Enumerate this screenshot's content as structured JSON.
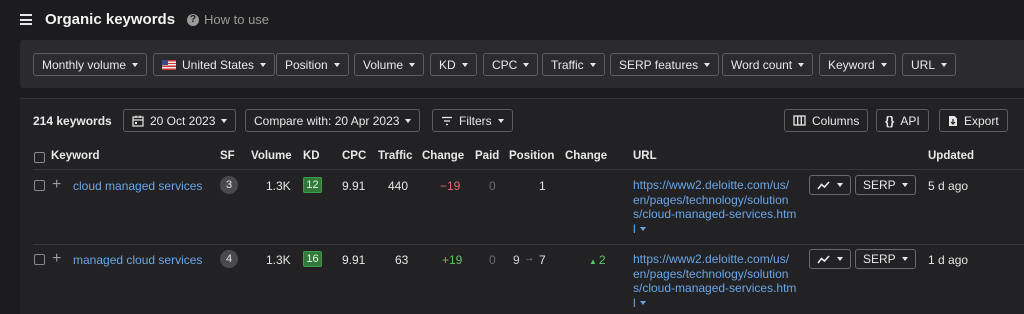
{
  "header": {
    "title": "Organic keywords",
    "how_to_use": "How to use"
  },
  "filters": [
    {
      "label": "Monthly volume"
    },
    {
      "label": "United States",
      "flag": "us-flag"
    },
    {
      "label": "Position"
    },
    {
      "label": "Volume"
    },
    {
      "label": "KD"
    },
    {
      "label": "CPC"
    },
    {
      "label": "Traffic"
    },
    {
      "label": "SERP features"
    },
    {
      "label": "Word count"
    },
    {
      "label": "Keyword"
    },
    {
      "label": "URL"
    }
  ],
  "toolbar": {
    "count": "214 keywords",
    "date": "20 Oct 2023",
    "compare": "Compare with: 20 Apr 2023",
    "filters_label": "Filters",
    "columns_label": "Columns",
    "api_label": "API",
    "export_label": "Export"
  },
  "table": {
    "columns": [
      "Keyword",
      "SF",
      "Volume",
      "KD",
      "CPC",
      "Traffic",
      "Change",
      "Paid",
      "Position",
      "Change",
      "URL",
      "Updated"
    ],
    "rows": [
      {
        "keyword": "cloud managed services",
        "sf": "3",
        "volume": "1.3K",
        "kd": "12",
        "cpc": "9.91",
        "traffic": "440",
        "traffic_change": "−19",
        "paid": "0",
        "position_from": "",
        "position": "1",
        "position_change": "",
        "url_lines": [
          "https://www2.deloitte.com/us/",
          "en/pages/technology/solution",
          "s/cloud-managed-services.htm",
          "l"
        ],
        "serp_label": "SERP",
        "updated": "5 d ago"
      },
      {
        "keyword": "managed cloud services",
        "sf": "4",
        "volume": "1.3K",
        "kd": "16",
        "cpc": "9.91",
        "traffic": "63",
        "traffic_change": "+19",
        "paid": "0",
        "position_from": "9",
        "position": "7",
        "position_change": "2",
        "url_lines": [
          "https://www2.deloitte.com/us/",
          "en/pages/technology/solution",
          "s/cloud-managed-services.htm",
          "l"
        ],
        "serp_label": "SERP",
        "updated": "1 d ago"
      }
    ]
  },
  "colors": {
    "background": "#1c1c1e",
    "link": "#6aa6e8",
    "kd_green": "#2f7a3a",
    "negative": "#e86a6a",
    "positive": "#5cc26b"
  }
}
